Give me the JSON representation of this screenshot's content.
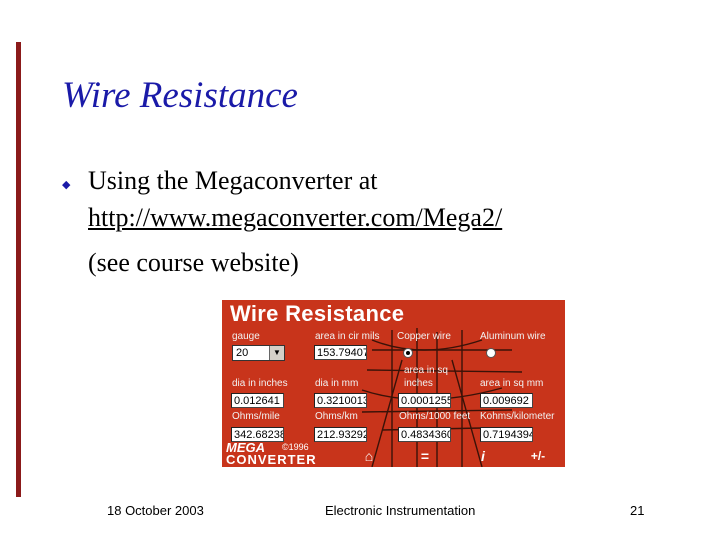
{
  "slide": {
    "title": "Wire Resistance",
    "bullet_glyph": "◆",
    "bullet_lines": [
      "Using the Megaconverter at",
      "http://www.megaconverter.com/Mega2/",
      "(see course website)"
    ]
  },
  "app": {
    "title": "Wire Resistance",
    "labels": {
      "gauge": "gauge",
      "area_cmils": "area in cir mils",
      "copper_wire": "Copper wire",
      "aluminum_wire": "Aluminum wire",
      "dia_inches": "dia in inches",
      "dia_mm": "dia in mm",
      "area_sq_inches_1": "area in sq",
      "area_sq_inches_2": "inches",
      "area_sq_mm": "area in sq mm",
      "ohms_mile": "Ohms/mile",
      "ohms_km": "Ohms/km",
      "ohms_1000ft": "Ohms/1000 feet",
      "ohms_kilometer": "Kohms/kilometer"
    },
    "gauge_value": "20",
    "material_selected": "copper",
    "values": {
      "area_cmils": "153.79407",
      "dia_inches": "0.012641",
      "dia_mm": "0.3210013",
      "area_sq_inches": "0.0001255",
      "area_sq_mm": "0.009692",
      "ohms_mile": "342.68238",
      "ohms_km": "212.93292",
      "ohms_1000ft": "0.4834360",
      "ohms_kilometer": "0.7194394"
    },
    "logo_top": "MEGA",
    "logo_bottom": "CONVERTER",
    "copyright": "©1996",
    "toolbar": {
      "home": "⌂",
      "equals": "=",
      "info": "i",
      "plus_minus": "+/-"
    }
  },
  "footer": {
    "date": "18 October 2003",
    "course": "Electronic Instrumentation",
    "page": "21"
  }
}
